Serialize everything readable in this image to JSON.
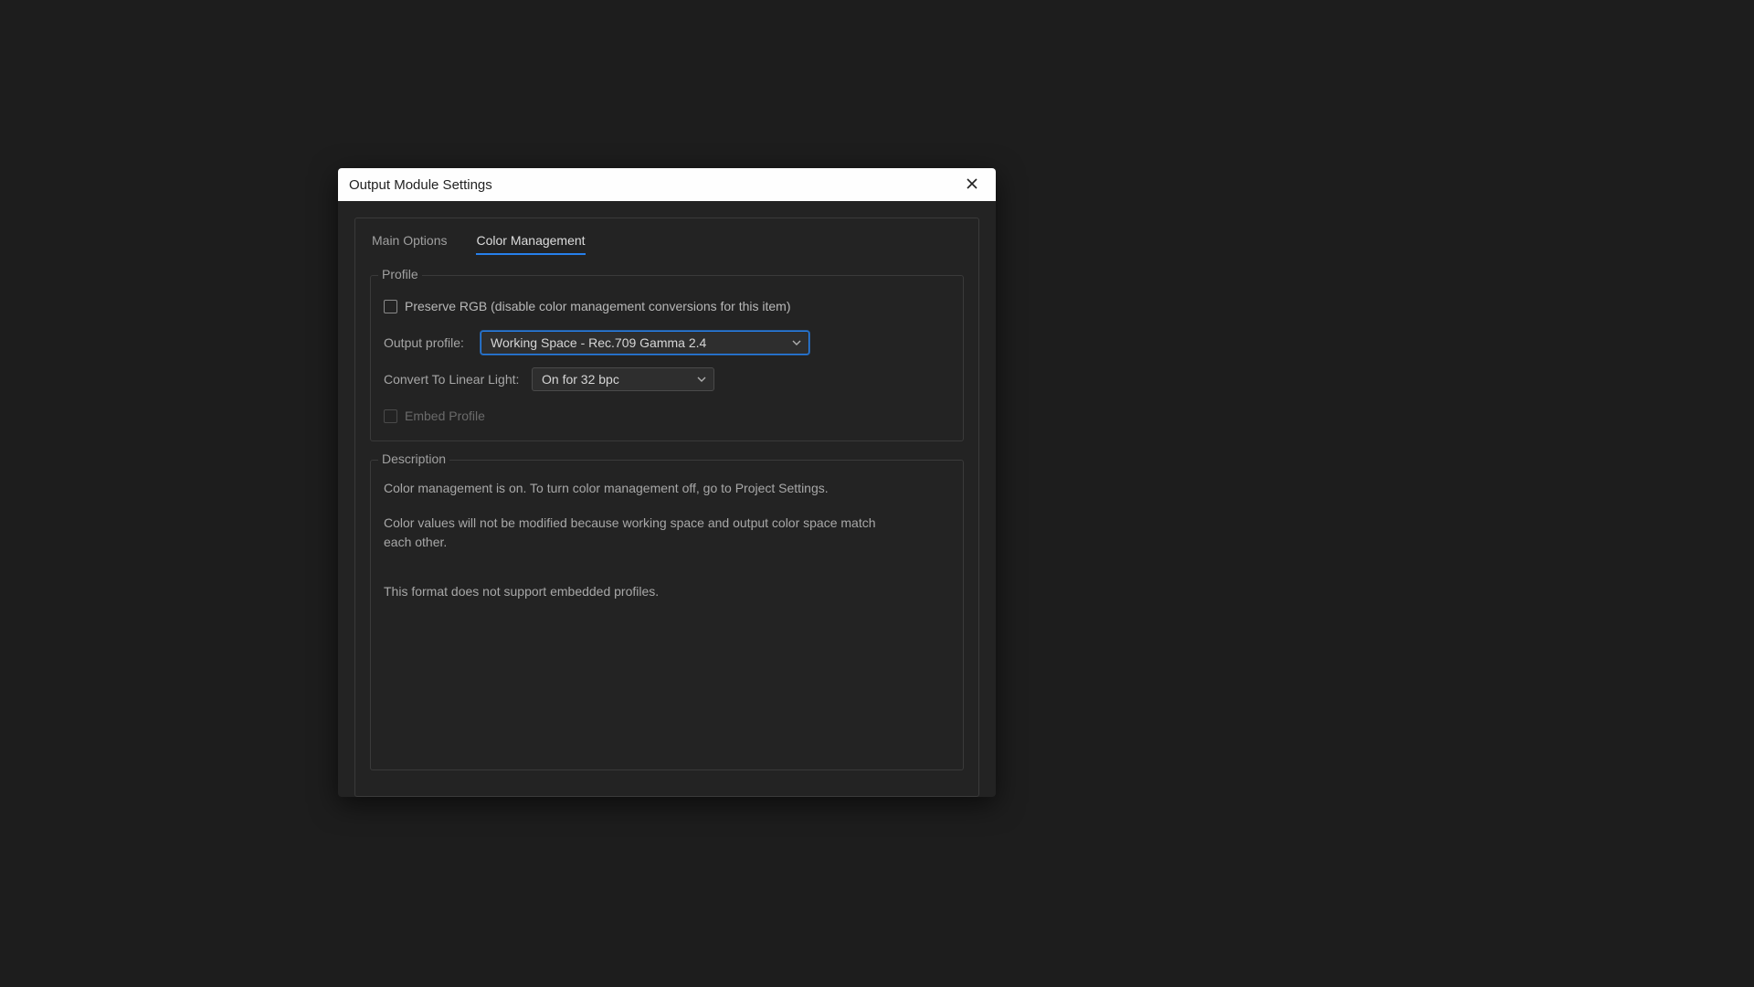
{
  "dialog": {
    "title": "Output Module Settings"
  },
  "tabs": {
    "main": "Main Options",
    "color": "Color Management"
  },
  "profile": {
    "legend": "Profile",
    "preserve_rgb_label": "Preserve RGB (disable color management conversions for this item)",
    "output_profile_label": "Output profile:",
    "output_profile_value": "Working Space - Rec.709 Gamma 2.4",
    "convert_linear_label": "Convert To Linear Light:",
    "convert_linear_value": "On for 32 bpc",
    "embed_profile_label": "Embed Profile"
  },
  "description": {
    "legend": "Description",
    "line1": "Color management is on. To turn color management off, go to Project Settings.",
    "line2": "Color values will not be modified because working space and output color space match each other.",
    "line3": "This format does not support embedded profiles."
  }
}
